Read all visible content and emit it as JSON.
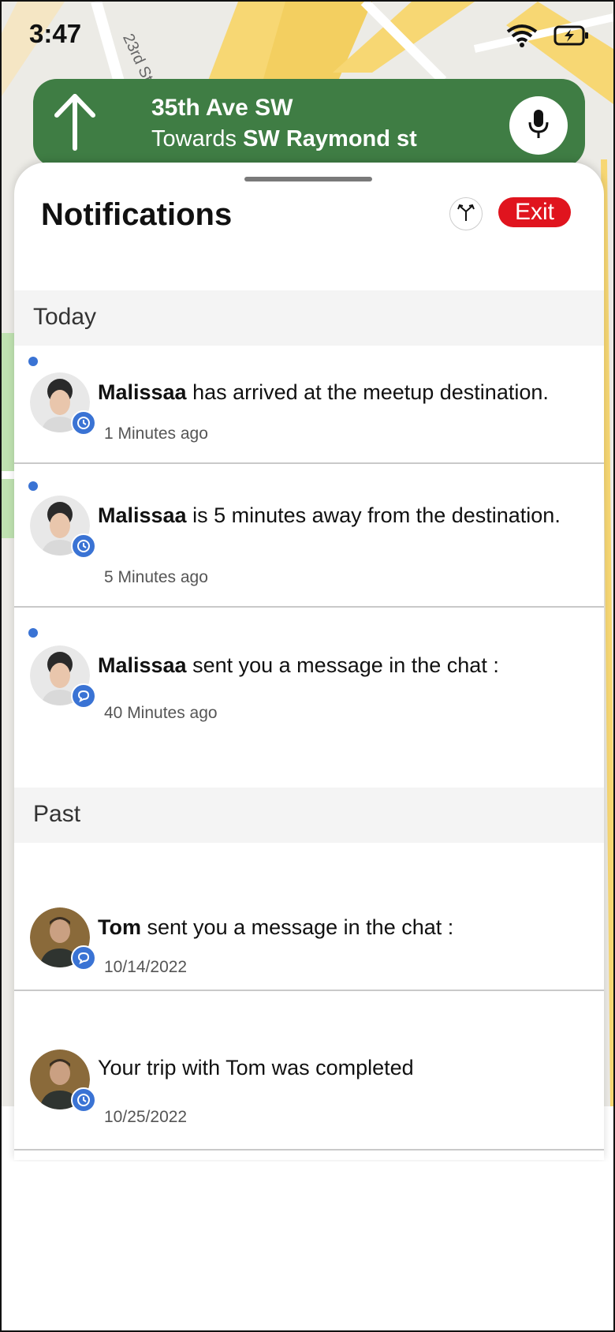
{
  "status_bar": {
    "time": "3:47"
  },
  "navigation": {
    "street": "35th Ave SW",
    "towards_prefix": "Towards",
    "towards_street": "SW Raymond st"
  },
  "map_labels": {
    "street_23rd": "23rd St"
  },
  "notifications": {
    "title": "Notifications",
    "exit_label": "Exit",
    "today_label": "Today",
    "past_label": "Past",
    "today": [
      {
        "name": "Malissaa",
        "text": "has arrived at the meetup destination.",
        "time": "1 Minutes ago",
        "badge_icon": "clock-icon",
        "unread": true
      },
      {
        "name": "Malissaa",
        "text": "is 5 minutes away from the destination.",
        "time": "5 Minutes ago",
        "badge_icon": "clock-icon",
        "unread": true
      },
      {
        "name": "Malissaa",
        "text": "sent you a message in the chat :",
        "time": "40 Minutes ago",
        "badge_icon": "chat-icon",
        "unread": true
      }
    ],
    "past": [
      {
        "name": "Tom",
        "text": "sent you a message in the chat :",
        "time": "10/14/2022",
        "badge_icon": "chat-icon"
      },
      {
        "name": "",
        "text": "Your trip with Tom was completed",
        "time": "10/25/2022",
        "badge_icon": "clock-icon"
      }
    ]
  },
  "colors": {
    "nav_green": "#3f7d44",
    "exit_red": "#e0141e",
    "accent_blue": "#3a73d4"
  }
}
